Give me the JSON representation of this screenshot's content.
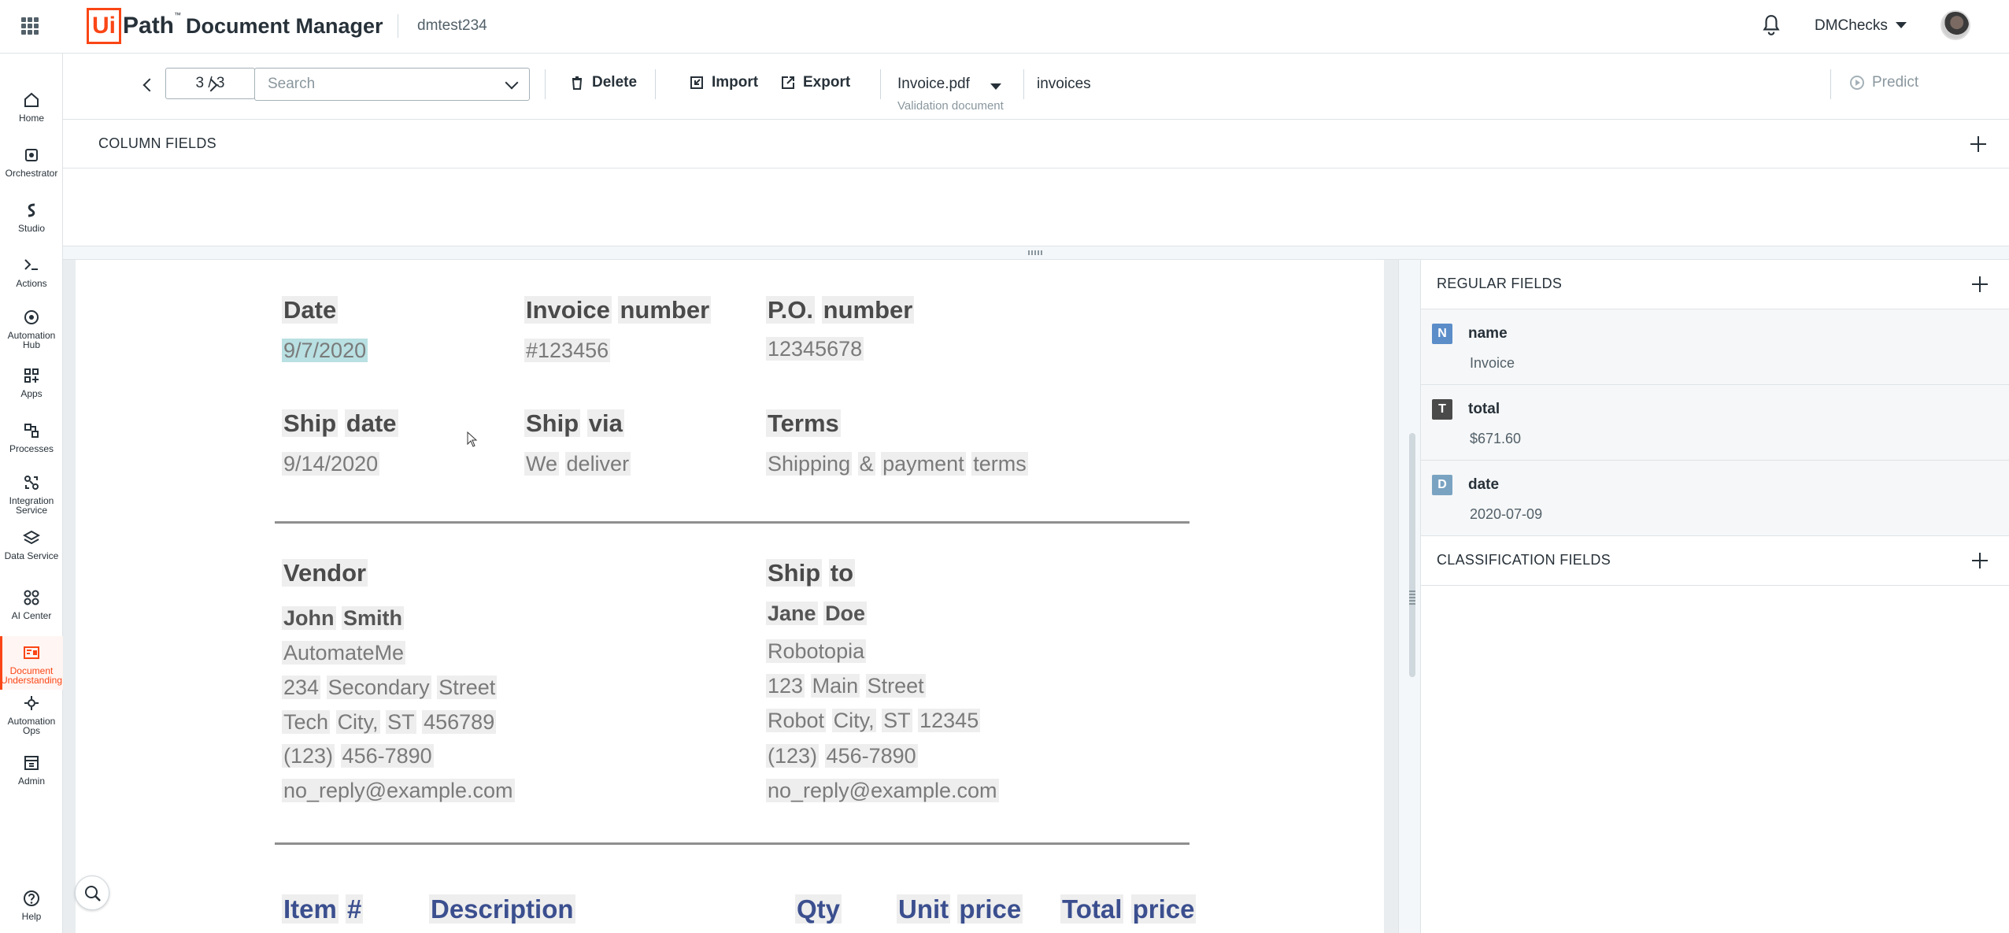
{
  "header": {
    "logo_ui": "Ui",
    "logo_path": "Path",
    "logo_tm": "™",
    "product": "Document Manager",
    "tenant": "dmtest234",
    "user": "DMChecks"
  },
  "nav": {
    "items": [
      {
        "label": "Home",
        "icon": "home-icon"
      },
      {
        "label": "Orchestrator",
        "icon": "orchestrator-icon"
      },
      {
        "label": "Studio",
        "icon": "studio-icon"
      },
      {
        "label": "Actions",
        "icon": "actions-icon"
      },
      {
        "label": "Automation Hub",
        "icon": "automation-hub-icon"
      },
      {
        "label": "Apps",
        "icon": "apps-icon"
      },
      {
        "label": "Processes",
        "icon": "processes-icon"
      },
      {
        "label": "Integration Service",
        "icon": "integration-service-icon"
      },
      {
        "label": "Data Service",
        "icon": "data-service-icon"
      },
      {
        "label": "AI Center",
        "icon": "ai-center-icon"
      },
      {
        "label": "Document Understanding",
        "icon": "document-understanding-icon",
        "active": true
      },
      {
        "label": "Automation Ops",
        "icon": "automation-ops-icon"
      },
      {
        "label": "Admin",
        "icon": "admin-icon"
      }
    ],
    "help": "Help"
  },
  "toolbar": {
    "page": "3 / 3",
    "search_placeholder": "Search",
    "delete": "Delete",
    "import": "Import",
    "export": "Export",
    "file_name": "Invoice.pdf",
    "file_sub": "Validation document",
    "doc_type": "invoices",
    "predict": "Predict"
  },
  "column_fields": {
    "title": "COLUMN FIELDS"
  },
  "document": {
    "date_label": "Date",
    "date_value": "9/7/2020",
    "invoice_label_1": "Invoice",
    "invoice_label_2": "number",
    "invoice_value": "#123456",
    "po_label_1": "P.O.",
    "po_label_2": "number",
    "po_value": "12345678",
    "shipdate_label_1": "Ship",
    "shipdate_label_2": "date",
    "shipdate_value": "9/14/2020",
    "shipvia_label_1": "Ship",
    "shipvia_label_2": "via",
    "shipvia_value_1": "We",
    "shipvia_value_2": "deliver",
    "terms_label": "Terms",
    "terms_value_1": "Shipping",
    "terms_value_2": "&",
    "terms_value_3": "payment",
    "terms_value_4": "terms",
    "vendor": {
      "label": "Vendor",
      "name_1": "John",
      "name_2": "Smith",
      "company": "AutomateMe",
      "street_1": "234",
      "street_2": "Secondary",
      "street_3": "Street",
      "city_1": "Tech",
      "city_2": "City,",
      "city_3": "ST",
      "city_4": "456789",
      "phone_1": "(123)",
      "phone_2": "456-7890",
      "email": "no_reply@example.com"
    },
    "shipto": {
      "label_1": "Ship",
      "label_2": "to",
      "name_1": "Jane",
      "name_2": "Doe",
      "company": "Robotopia",
      "street_1": "123",
      "street_2": "Main",
      "street_3": "Street",
      "city_1": "Robot",
      "city_2": "City,",
      "city_3": "ST",
      "city_4": "12345",
      "phone_1": "(123)",
      "phone_2": "456-7890",
      "email": "no_reply@example.com"
    },
    "table_headers": {
      "item_1": "Item",
      "item_2": "#",
      "description": "Description",
      "qty": "Qty",
      "unit_1": "Unit",
      "unit_2": "price",
      "total_1": "Total",
      "total_2": "price"
    }
  },
  "regular_fields": {
    "title": "REGULAR FIELDS",
    "fields": [
      {
        "badge": "N",
        "name": "name",
        "value": "Invoice",
        "color": "#5b8dc9"
      },
      {
        "badge": "T",
        "name": "total",
        "value": "$671.60",
        "color": "#4a4a4a"
      },
      {
        "badge": "D",
        "name": "date",
        "value": "2020-07-09",
        "color": "#7aa3c2"
      }
    ]
  },
  "classification_fields": {
    "title": "CLASSIFICATION FIELDS"
  }
}
